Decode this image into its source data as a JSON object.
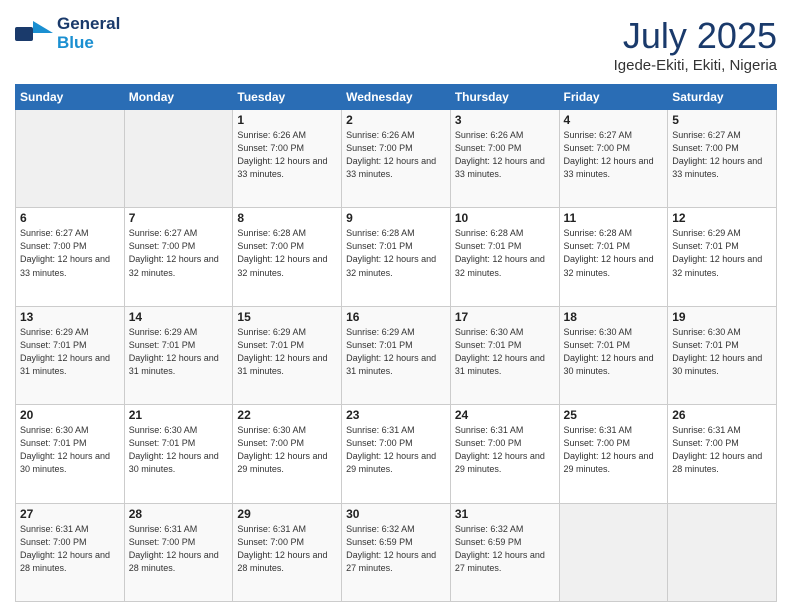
{
  "header": {
    "logo_general": "General",
    "logo_blue": "Blue",
    "month": "July 2025",
    "location": "Igede-Ekiti, Ekiti, Nigeria"
  },
  "weekdays": [
    "Sunday",
    "Monday",
    "Tuesday",
    "Wednesday",
    "Thursday",
    "Friday",
    "Saturday"
  ],
  "weeks": [
    [
      {
        "day": "",
        "info": ""
      },
      {
        "day": "",
        "info": ""
      },
      {
        "day": "1",
        "info": "Sunrise: 6:26 AM\nSunset: 7:00 PM\nDaylight: 12 hours and 33 minutes."
      },
      {
        "day": "2",
        "info": "Sunrise: 6:26 AM\nSunset: 7:00 PM\nDaylight: 12 hours and 33 minutes."
      },
      {
        "day": "3",
        "info": "Sunrise: 6:26 AM\nSunset: 7:00 PM\nDaylight: 12 hours and 33 minutes."
      },
      {
        "day": "4",
        "info": "Sunrise: 6:27 AM\nSunset: 7:00 PM\nDaylight: 12 hours and 33 minutes."
      },
      {
        "day": "5",
        "info": "Sunrise: 6:27 AM\nSunset: 7:00 PM\nDaylight: 12 hours and 33 minutes."
      }
    ],
    [
      {
        "day": "6",
        "info": "Sunrise: 6:27 AM\nSunset: 7:00 PM\nDaylight: 12 hours and 33 minutes."
      },
      {
        "day": "7",
        "info": "Sunrise: 6:27 AM\nSunset: 7:00 PM\nDaylight: 12 hours and 32 minutes."
      },
      {
        "day": "8",
        "info": "Sunrise: 6:28 AM\nSunset: 7:00 PM\nDaylight: 12 hours and 32 minutes."
      },
      {
        "day": "9",
        "info": "Sunrise: 6:28 AM\nSunset: 7:01 PM\nDaylight: 12 hours and 32 minutes."
      },
      {
        "day": "10",
        "info": "Sunrise: 6:28 AM\nSunset: 7:01 PM\nDaylight: 12 hours and 32 minutes."
      },
      {
        "day": "11",
        "info": "Sunrise: 6:28 AM\nSunset: 7:01 PM\nDaylight: 12 hours and 32 minutes."
      },
      {
        "day": "12",
        "info": "Sunrise: 6:29 AM\nSunset: 7:01 PM\nDaylight: 12 hours and 32 minutes."
      }
    ],
    [
      {
        "day": "13",
        "info": "Sunrise: 6:29 AM\nSunset: 7:01 PM\nDaylight: 12 hours and 31 minutes."
      },
      {
        "day": "14",
        "info": "Sunrise: 6:29 AM\nSunset: 7:01 PM\nDaylight: 12 hours and 31 minutes."
      },
      {
        "day": "15",
        "info": "Sunrise: 6:29 AM\nSunset: 7:01 PM\nDaylight: 12 hours and 31 minutes."
      },
      {
        "day": "16",
        "info": "Sunrise: 6:29 AM\nSunset: 7:01 PM\nDaylight: 12 hours and 31 minutes."
      },
      {
        "day": "17",
        "info": "Sunrise: 6:30 AM\nSunset: 7:01 PM\nDaylight: 12 hours and 31 minutes."
      },
      {
        "day": "18",
        "info": "Sunrise: 6:30 AM\nSunset: 7:01 PM\nDaylight: 12 hours and 30 minutes."
      },
      {
        "day": "19",
        "info": "Sunrise: 6:30 AM\nSunset: 7:01 PM\nDaylight: 12 hours and 30 minutes."
      }
    ],
    [
      {
        "day": "20",
        "info": "Sunrise: 6:30 AM\nSunset: 7:01 PM\nDaylight: 12 hours and 30 minutes."
      },
      {
        "day": "21",
        "info": "Sunrise: 6:30 AM\nSunset: 7:01 PM\nDaylight: 12 hours and 30 minutes."
      },
      {
        "day": "22",
        "info": "Sunrise: 6:30 AM\nSunset: 7:00 PM\nDaylight: 12 hours and 29 minutes."
      },
      {
        "day": "23",
        "info": "Sunrise: 6:31 AM\nSunset: 7:00 PM\nDaylight: 12 hours and 29 minutes."
      },
      {
        "day": "24",
        "info": "Sunrise: 6:31 AM\nSunset: 7:00 PM\nDaylight: 12 hours and 29 minutes."
      },
      {
        "day": "25",
        "info": "Sunrise: 6:31 AM\nSunset: 7:00 PM\nDaylight: 12 hours and 29 minutes."
      },
      {
        "day": "26",
        "info": "Sunrise: 6:31 AM\nSunset: 7:00 PM\nDaylight: 12 hours and 28 minutes."
      }
    ],
    [
      {
        "day": "27",
        "info": "Sunrise: 6:31 AM\nSunset: 7:00 PM\nDaylight: 12 hours and 28 minutes."
      },
      {
        "day": "28",
        "info": "Sunrise: 6:31 AM\nSunset: 7:00 PM\nDaylight: 12 hours and 28 minutes."
      },
      {
        "day": "29",
        "info": "Sunrise: 6:31 AM\nSunset: 7:00 PM\nDaylight: 12 hours and 28 minutes."
      },
      {
        "day": "30",
        "info": "Sunrise: 6:32 AM\nSunset: 6:59 PM\nDaylight: 12 hours and 27 minutes."
      },
      {
        "day": "31",
        "info": "Sunrise: 6:32 AM\nSunset: 6:59 PM\nDaylight: 12 hours and 27 minutes."
      },
      {
        "day": "",
        "info": ""
      },
      {
        "day": "",
        "info": ""
      }
    ]
  ]
}
